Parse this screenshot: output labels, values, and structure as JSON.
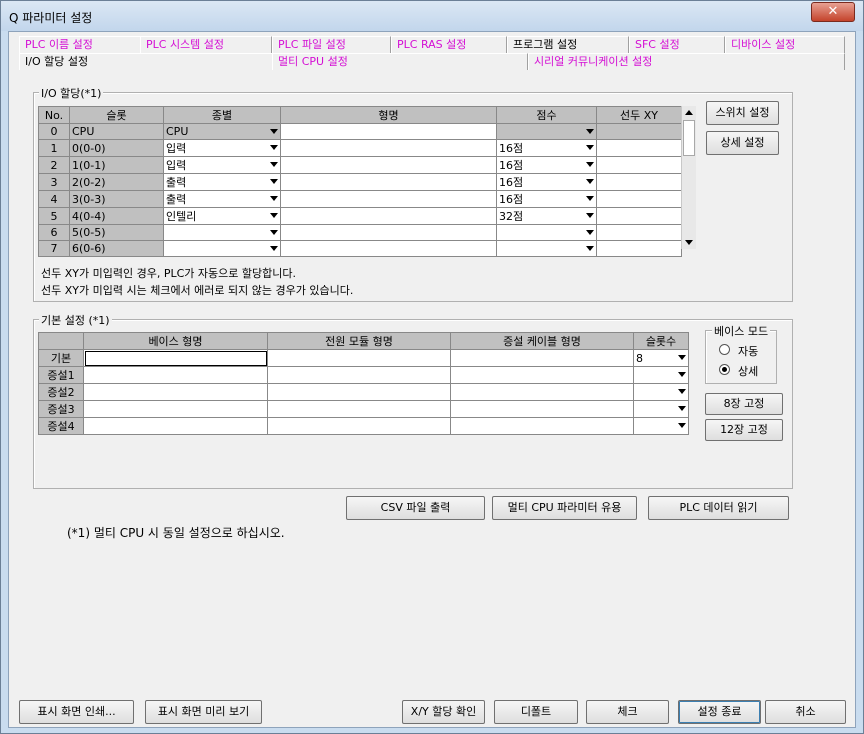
{
  "window": {
    "title": "Q 파라미터 설정",
    "close": "✕"
  },
  "tabs_row1": [
    {
      "label": "PLC 이름 설정"
    },
    {
      "label": "PLC 시스템 설정"
    },
    {
      "label": "PLC 파일 설정"
    },
    {
      "label": "PLC RAS 설정"
    },
    {
      "label": "프로그램 설정"
    },
    {
      "label": "SFC 설정"
    },
    {
      "label": "디바이스 설정"
    }
  ],
  "tabs_row2": [
    {
      "label": "I/O 할당 설정"
    },
    {
      "label": "멀티 CPU 설정"
    },
    {
      "label": "시리얼 커뮤니케이션 설정"
    }
  ],
  "io": {
    "group_label": "I/O 할당(*1)",
    "headers": [
      "No.",
      "슬롯",
      "종별",
      "형명",
      "점수",
      "선두 XY"
    ],
    "rows": [
      {
        "no": "0",
        "slot": "CPU",
        "type": "CPU",
        "model": "",
        "points": "",
        "xy": ""
      },
      {
        "no": "1",
        "slot": "0(0-0)",
        "type": "입력",
        "model": "",
        "points": "16점",
        "xy": ""
      },
      {
        "no": "2",
        "slot": "1(0-1)",
        "type": "입력",
        "model": "",
        "points": "16점",
        "xy": ""
      },
      {
        "no": "3",
        "slot": "2(0-2)",
        "type": "출력",
        "model": "",
        "points": "16점",
        "xy": ""
      },
      {
        "no": "4",
        "slot": "3(0-3)",
        "type": "출력",
        "model": "",
        "points": "16점",
        "xy": ""
      },
      {
        "no": "5",
        "slot": "4(0-4)",
        "type": "인텔리",
        "model": "",
        "points": "32점",
        "xy": ""
      },
      {
        "no": "6",
        "slot": "5(0-5)",
        "type": "",
        "model": "",
        "points": "",
        "xy": ""
      },
      {
        "no": "7",
        "slot": "6(0-6)",
        "type": "",
        "model": "",
        "points": "",
        "xy": ""
      }
    ],
    "note1": "선두 XY가 미입력인 경우, PLC가 자동으로 할당합니다.",
    "note2": "선두 XY가 미입력 시는 체크에서 에러로 되지 않는 경우가 있습니다.",
    "switch_button": "스위치 설정",
    "detail_button": "상세 설정"
  },
  "base": {
    "group_label": "기본 설정 (*1)",
    "headers": [
      "",
      "베이스 형명",
      "전원 모듈 형명",
      "증설 케이블 형명",
      "슬롯수"
    ],
    "rows": [
      {
        "label": "기본",
        "slots": "8"
      },
      {
        "label": "증설1",
        "slots": ""
      },
      {
        "label": "증설2",
        "slots": ""
      },
      {
        "label": "증설3",
        "slots": ""
      },
      {
        "label": "증설4",
        "slots": ""
      }
    ],
    "mode_label": "베이스 모드",
    "mode_auto": "자동",
    "mode_detail": "상세",
    "btn8": "8장 고정",
    "btn12": "12장 고정"
  },
  "actions": {
    "csv": "CSV 파일 출력",
    "multi": "멀티 CPU 파라미터 유용",
    "plc_read": "PLC 데이터 읽기"
  },
  "footnote": "(*1) 멀티 CPU 시 동일 설정으로 하십시오.",
  "bottom": {
    "print": "표시 화면 인쇄...",
    "preview": "표시 화면 미리 보기",
    "xy": "X/Y 할당 확인",
    "default": "디폴트",
    "check": "체크",
    "end": "설정 종료",
    "cancel": "취소"
  }
}
